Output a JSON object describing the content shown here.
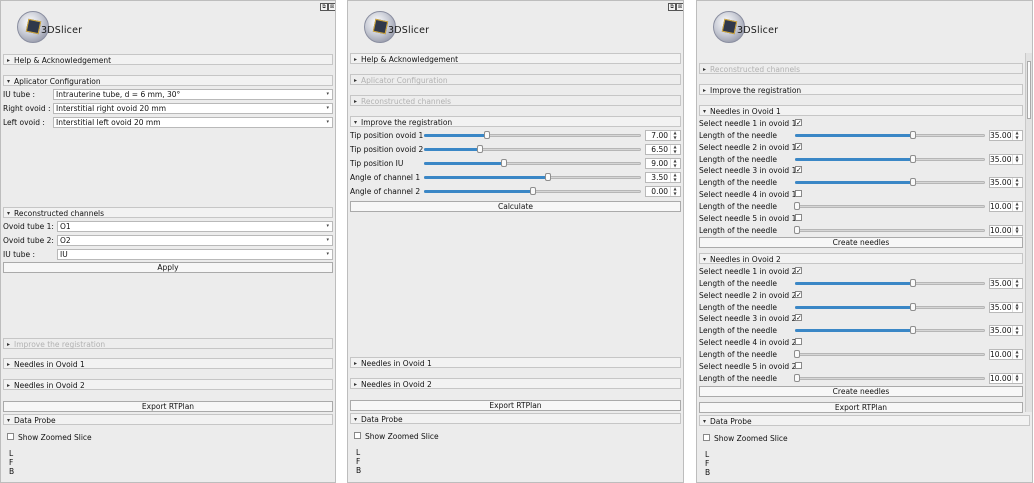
{
  "app": {
    "logo_text": "3DSlicer",
    "window_buttons": [
      "⧉",
      "⊠"
    ]
  },
  "left": {
    "help": "Help & Acknowledgement",
    "applicator": {
      "title": "Aplicator Configuration",
      "rows": [
        {
          "label": "IU tube :",
          "value": "Intrauterine tube, d = 6 mm, 30°"
        },
        {
          "label": "Right ovoid :",
          "value": "Interstitial right ovoid 20 mm"
        },
        {
          "label": "Left ovoid :",
          "value": "Interstitial left ovoid 20 mm"
        }
      ]
    },
    "reconstructed": {
      "title": "Reconstructed channels",
      "rows": [
        {
          "label": "Ovoid tube 1:",
          "value": "O1"
        },
        {
          "label": "Ovoid tube 2:",
          "value": "O2"
        },
        {
          "label": "IU tube :",
          "value": "IU"
        }
      ],
      "apply": "Apply"
    },
    "improve": "Improve the registration",
    "needles1": "Needles in Ovoid 1",
    "needles2": "Needles in Ovoid 2",
    "export": "Export RTPlan",
    "probe": {
      "title": "Data Probe",
      "checkbox": "Show Zoomed Slice",
      "lfb": [
        "L",
        "F",
        "B"
      ]
    }
  },
  "middle": {
    "help": "Help & Acknowledgement",
    "applicator": "Aplicator Configuration",
    "reconstructed": "Reconstructed channels",
    "improve": {
      "title": "Improve the registration",
      "rows": [
        {
          "label": "Tip position ovoid 1",
          "value": "7.00",
          "frac": 0.29
        },
        {
          "label": "Tip position ovoid 2",
          "value": "6.50",
          "frac": 0.26
        },
        {
          "label": "Tip position IU",
          "value": "9.00",
          "frac": 0.37
        },
        {
          "label": "Angle of channel 1",
          "value": "3.50",
          "frac": 0.57
        },
        {
          "label": "Angle of channel 2",
          "value": "0.00",
          "frac": 0.5
        }
      ],
      "calculate": "Calculate"
    },
    "needles1": "Needles in Ovoid 1",
    "needles2": "Needles in Ovoid 2",
    "export": "Export RTPlan",
    "probe": {
      "title": "Data Probe",
      "checkbox": "Show Zoomed Slice",
      "lfb": [
        "L",
        "F",
        "B"
      ]
    }
  },
  "right": {
    "reconstructed": "Reconstructed channels",
    "improve": "Improve the registration",
    "ovoid1": {
      "title": "Needles in Ovoid 1",
      "needles": [
        {
          "select": "Select needle 1 in ovoid 1",
          "checked": true,
          "length_label": "Length of the needle",
          "value": "35.00",
          "frac": 0.62
        },
        {
          "select": "Select needle 2 in ovoid 1",
          "checked": true,
          "length_label": "Length of the needle",
          "value": "35.00",
          "frac": 0.62
        },
        {
          "select": "Select needle 3 in ovoid 1",
          "checked": true,
          "length_label": "Length of the needle",
          "value": "35.00",
          "frac": 0.62
        },
        {
          "select": "Select needle 4 in ovoid 1",
          "checked": false,
          "length_label": "Length of the needle",
          "value": "10.00",
          "frac": 0.01
        },
        {
          "select": "Select needle 5 in ovoid 1",
          "checked": false,
          "length_label": "Length of the needle",
          "value": "10.00",
          "frac": 0.01
        }
      ],
      "create": "Create needles"
    },
    "ovoid2": {
      "title": "Needles in Ovoid 2",
      "needles": [
        {
          "select": "Select needle 1 in ovoid 2",
          "checked": true,
          "length_label": "Length of the needle",
          "value": "35.00",
          "frac": 0.62
        },
        {
          "select": "Select needle 2 in ovoid 2",
          "checked": true,
          "length_label": "Length of the needle",
          "value": "35.00",
          "frac": 0.62
        },
        {
          "select": "Select needle 3 in ovoid 2",
          "checked": true,
          "length_label": "Length of the needle",
          "value": "35.00",
          "frac": 0.62
        },
        {
          "select": "Select needle 4 in ovoid 2",
          "checked": false,
          "length_label": "Length of the needle",
          "value": "10.00",
          "frac": 0.01
        },
        {
          "select": "Select needle 5 in ovoid 2",
          "checked": false,
          "length_label": "Length of the needle",
          "value": "10.00",
          "frac": 0.01
        }
      ],
      "create": "Create needles"
    },
    "export": "Export RTPlan",
    "probe": {
      "title": "Data Probe",
      "checkbox": "Show Zoomed Slice",
      "lfb": [
        "L",
        "F",
        "B"
      ]
    }
  },
  "icons": {
    "expanded": "▾",
    "collapsed": "▸",
    "combo": "▾",
    "spin_up": "▲",
    "spin_down": "▼",
    "check": "✓"
  },
  "colors": {
    "slider_fill": "#3a87c6",
    "panel_bg": "#ececec",
    "disabled_text": "#b2b2b2"
  }
}
